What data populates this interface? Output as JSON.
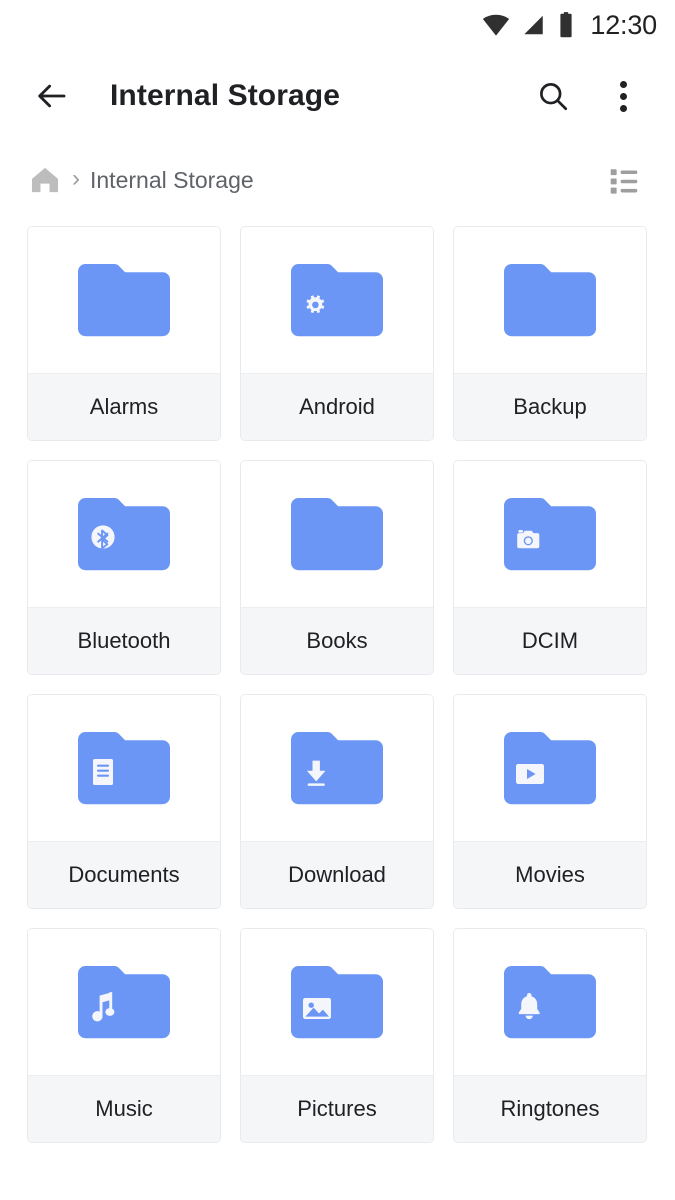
{
  "status_bar": {
    "wifi_icon": "wifi-icon",
    "signal_icon": "cellular-signal-icon",
    "battery_icon": "battery-full-icon",
    "time": "12:30"
  },
  "app_bar": {
    "back_icon": "back-arrow-icon",
    "title": "Internal Storage",
    "search_icon": "search-icon",
    "overflow_icon": "more-vertical-icon"
  },
  "breadcrumb": {
    "home_icon": "home-icon",
    "separator": "›",
    "path_label": "Internal Storage",
    "view_toggle_icon": "list-view-icon"
  },
  "colors": {
    "folder_blue": "#6b96f5",
    "badge_white": "#f4f6fb",
    "label_bg": "#f5f6f7",
    "card_border": "#e8eaed",
    "text_primary": "#202124",
    "text_secondary": "#5f6368",
    "icon_gray": "#bdbdbd"
  },
  "grid": {
    "items": [
      {
        "label": "Alarms",
        "badge": "none"
      },
      {
        "label": "Android",
        "badge": "gear-badge-icon"
      },
      {
        "label": "Backup",
        "badge": "none"
      },
      {
        "label": "Bluetooth",
        "badge": "bluetooth-badge-icon"
      },
      {
        "label": "Books",
        "badge": "none"
      },
      {
        "label": "DCIM",
        "badge": "camera-badge-icon"
      },
      {
        "label": "Documents",
        "badge": "document-badge-icon"
      },
      {
        "label": "Download",
        "badge": "download-badge-icon"
      },
      {
        "label": "Movies",
        "badge": "play-badge-icon"
      },
      {
        "label": "Music",
        "badge": "music-note-badge-icon"
      },
      {
        "label": "Pictures",
        "badge": "image-badge-icon"
      },
      {
        "label": "Ringtones",
        "badge": "bell-badge-icon"
      }
    ]
  }
}
